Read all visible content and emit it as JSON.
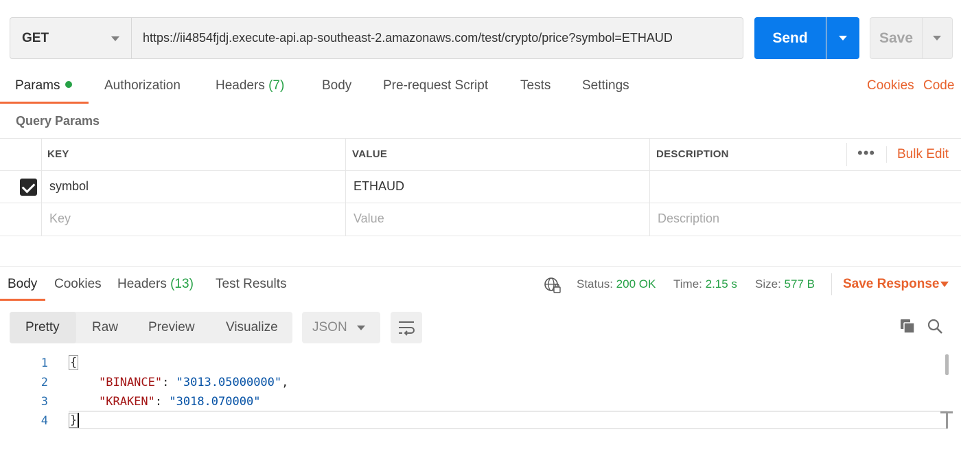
{
  "request": {
    "method": "GET",
    "url": "https://ii4854fjdj.execute-api.ap-southeast-2.amazonaws.com/test/crypto/price?symbol=ETHAUD",
    "send_label": "Send",
    "save_label": "Save"
  },
  "request_tabs": {
    "params": "Params",
    "authorization": "Authorization",
    "headers": "Headers",
    "headers_count": "(7)",
    "body": "Body",
    "prerequest": "Pre-request Script",
    "tests": "Tests",
    "settings": "Settings",
    "cookies": "Cookies",
    "code": "Code"
  },
  "query_params": {
    "title": "Query Params",
    "columns": [
      "KEY",
      "VALUE",
      "DESCRIPTION"
    ],
    "bulk_edit": "Bulk Edit",
    "rows": [
      {
        "checked": true,
        "key": "symbol",
        "value": "ETHAUD",
        "description": ""
      }
    ],
    "placeholders": {
      "key": "Key",
      "value": "Value",
      "description": "Description"
    }
  },
  "response_tabs": {
    "body": "Body",
    "cookies": "Cookies",
    "headers": "Headers",
    "headers_count": "(13)",
    "test_results": "Test Results"
  },
  "response_meta": {
    "status_label": "Status:",
    "status_value": "200 OK",
    "time_label": "Time:",
    "time_value": "2.15 s",
    "size_label": "Size:",
    "size_value": "577 B",
    "save_response": "Save Response"
  },
  "view_options": {
    "pretty": "Pretty",
    "raw": "Raw",
    "preview": "Preview",
    "visualize": "Visualize",
    "format": "JSON"
  },
  "response_body": {
    "line_numbers": [
      "1",
      "2",
      "3",
      "4"
    ],
    "open_brace": "{",
    "close_brace": "}",
    "entries": [
      {
        "key": "\"BINANCE\"",
        "value": "\"3013.05000000\"",
        "trail": ","
      },
      {
        "key": "\"KRAKEN\"",
        "value": "\"3018.070000\"",
        "trail": ""
      }
    ]
  },
  "colors": {
    "accent": "#f26b3a",
    "send": "#097bed",
    "success": "#26a146"
  },
  "icons": [
    "caret-down-icon",
    "globe-lock-icon",
    "wrap-lines-icon",
    "copy-icon",
    "search-icon",
    "more-icon",
    "checkbox-checked-icon"
  ]
}
